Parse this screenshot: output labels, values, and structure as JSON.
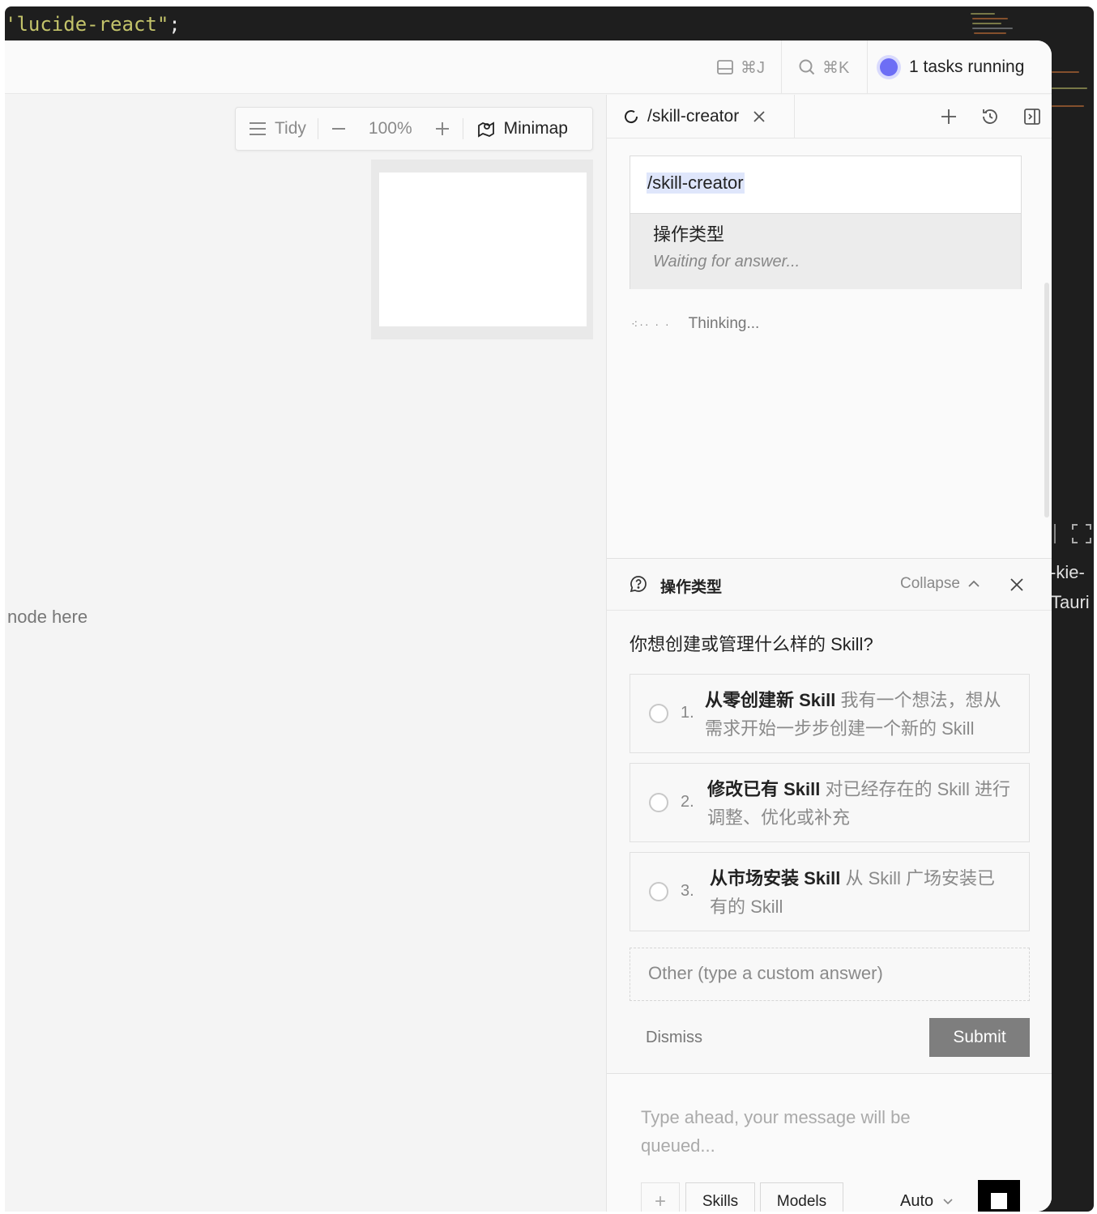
{
  "editor": {
    "code_text": "'lucide-react\"",
    "code_punct": ";",
    "right_partial_1": "-kie-",
    "right_partial_2": "Tauri"
  },
  "topbar": {
    "panel_shortcut": "⌘J",
    "search_shortcut": "⌘K",
    "tasks_label": "1 tasks running",
    "tasks_color": "#6d6ef5"
  },
  "canvas": {
    "toolbar": {
      "tidy_label": "Tidy",
      "zoom_level": "100%",
      "minimap_label": "Minimap"
    },
    "placeholder_text": "node here"
  },
  "panel": {
    "tab": {
      "label": "/skill-creator"
    },
    "message": {
      "command": "/skill-creator",
      "question_title": "操作类型",
      "question_status": "Waiting for answer..."
    },
    "thinking_label": "Thinking...",
    "question_panel": {
      "title": "操作类型",
      "collapse_label": "Collapse",
      "question": "你想创建或管理什么样的 Skill?",
      "options": [
        {
          "number": "1.",
          "title": "从零创建新 Skill",
          "description": "我有一个想法，想从需求开始一步步创建一个新的 Skill"
        },
        {
          "number": "2.",
          "title": "修改已有 Skill",
          "description": "对已经存在的 Skill 进行调整、优化或补充"
        },
        {
          "number": "3.",
          "title": "从市场安装 Skill",
          "description": "从 Skill 广场安装已有的 Skill"
        }
      ],
      "other_placeholder": "Other (type a custom answer)",
      "dismiss_label": "Dismiss",
      "submit_label": "Submit"
    },
    "composer": {
      "placeholder": "Type ahead, your message will be queued...",
      "add_label": "+",
      "skills_label": "Skills",
      "models_label": "Models",
      "model_value": "Auto"
    }
  }
}
